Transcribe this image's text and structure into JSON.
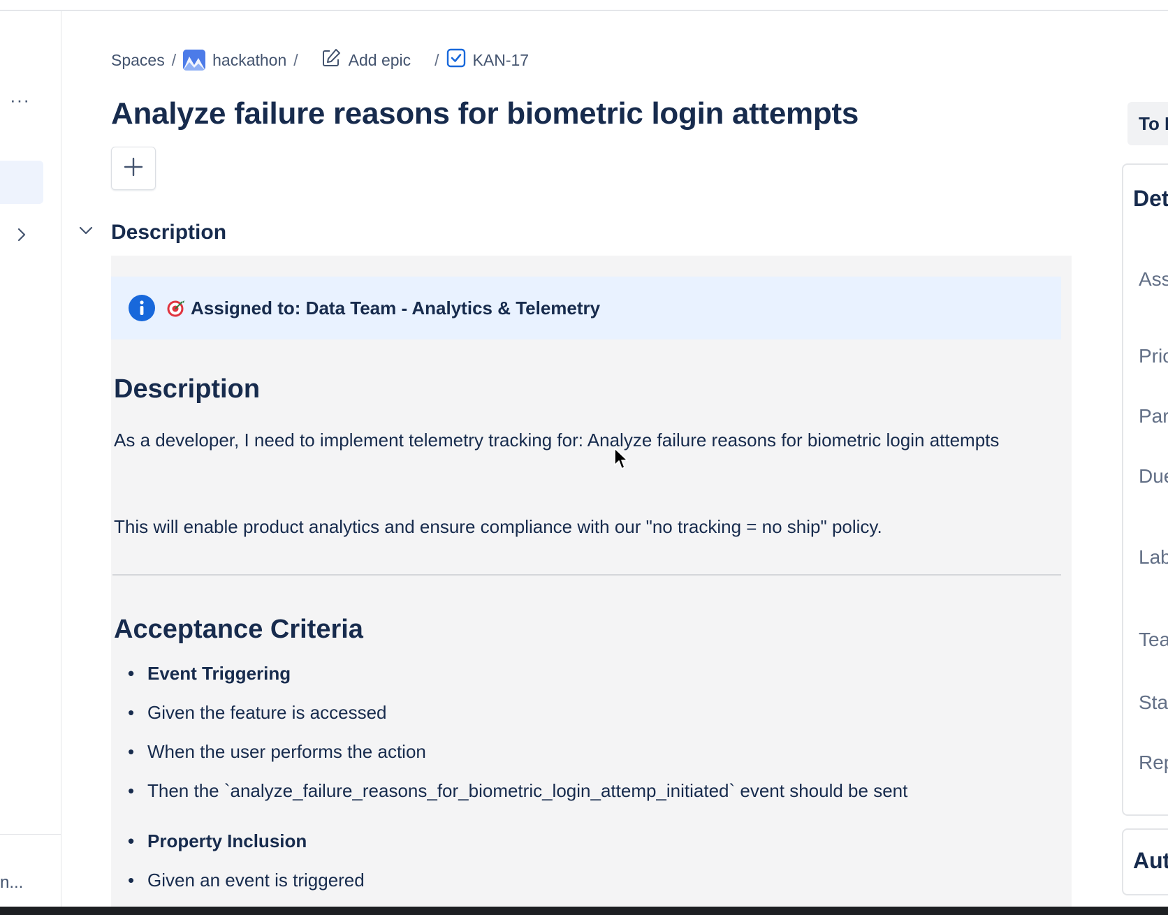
{
  "breadcrumb": {
    "spaces": "Spaces",
    "separator": "/",
    "project": "hackathon",
    "add_epic": "Add epic",
    "issue_key": "KAN-17"
  },
  "issue": {
    "title": "Analyze failure reasons for biometric login attempts",
    "add_button": "+"
  },
  "description_section": {
    "heading": "Description",
    "info_panel": {
      "text": "Assigned to: Data Team - Analytics & Telemetry"
    },
    "body_heading": "Description",
    "paragraph_1": "As a developer, I need to implement telemetry tracking for: Analyze failure reasons for biometric login attempts",
    "paragraph_2": "This will enable product analytics and ensure compliance with our \"no tracking = no ship\" policy.",
    "acceptance_heading": "Acceptance Criteria",
    "criteria": [
      "Event Triggering",
      "Given the feature is accessed",
      "When the user performs the action",
      "Then the `analyze_failure_reasons_for_biometric_login_attemp_initiated` event should be sent",
      "Property Inclusion",
      "Given an event is triggered"
    ]
  },
  "left_rail": {
    "more": "···",
    "truncated_label": "n..."
  },
  "right_panel": {
    "status_button": "To D",
    "details_title": "Details",
    "fields": [
      "Ass",
      "Prio",
      "Par",
      "Due",
      "Lab",
      "Tea",
      "Sta",
      "Rep"
    ],
    "automation_title": "Aut"
  },
  "colors": {
    "accent_blue": "#1868db",
    "info_bg": "#e9f2ff",
    "panel_bg": "#f4f4f5",
    "text": "#172b4d"
  }
}
